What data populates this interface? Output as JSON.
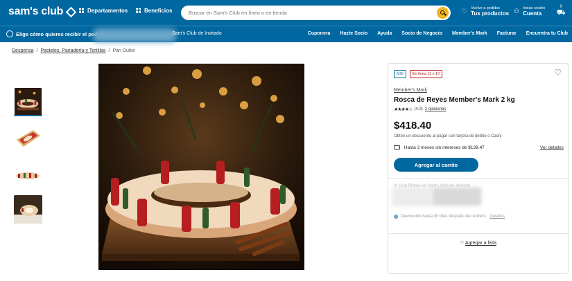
{
  "header": {
    "logo": "sam's club",
    "departments": "Departamentos",
    "benefits": "Beneficios",
    "search_placeholder": "Buscar en Sam's Club en línea o en tienda",
    "orders_small": "Vuelve a pedidos",
    "orders_big": "Tus productos",
    "account_small": "Iniciar sesión",
    "account_big": "Cuenta",
    "cart_count": "0"
  },
  "subbar": {
    "deliver_text": "Elige cómo quieres recibir el pedido",
    "club_text": "Sam's Club de Invitado",
    "links": [
      "Cuponera",
      "Hazte Socio",
      "Ayuda",
      "Socio de Negocio",
      "Member's Mark",
      "Facturar",
      "Encuentra tu Club"
    ]
  },
  "breadcrumb": [
    "Despensa",
    "Pasteles, Panadería y Tortillas",
    "Pan Dulce"
  ],
  "product": {
    "tag_msi": "MSI",
    "tag_online": "En línea 11 x 10",
    "brand": "Member's Mark",
    "name": "Rosca de Reyes Member's Mark 2 kg",
    "stars": "★★★★☆",
    "rating": "(4.0)",
    "opinions": "2 opiniones",
    "price": "$418.40",
    "discount": "Obtén un descuento al pagar con tarjeta de débito o Cashi",
    "installments": "Hasta 3 meses sin intereses de $139.47",
    "details": "Ver detalles",
    "add_to_cart": "Agregar al carrito",
    "pickup": "Club Pickup en Sam's Club de Invitado",
    "returns": "Devolución hasta 30 días después de recibirlo.",
    "returns_link": "Detalles",
    "add_to_list": "Agregar a lista"
  }
}
